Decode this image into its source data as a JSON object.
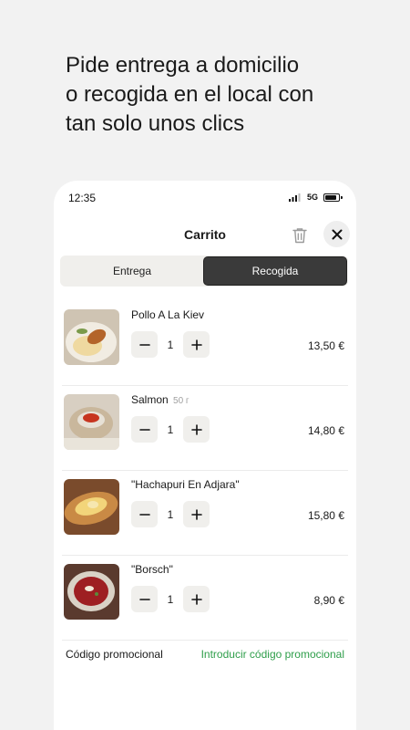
{
  "headline": {
    "line1": "Pide entrega a domicilio",
    "line2": "o recogida en el local con",
    "line3": "tan solo unos clics"
  },
  "status_bar": {
    "time": "12:35",
    "network": "5G"
  },
  "cart": {
    "title": "Carrito",
    "tabs": [
      {
        "label": "Entrega",
        "active": false
      },
      {
        "label": "Recogida",
        "active": true
      }
    ],
    "items": [
      {
        "name": "Pollo A La Kiev",
        "weight": "",
        "quantity": "1",
        "price": "13,50 €"
      },
      {
        "name": "Salmon",
        "weight": "50 г",
        "quantity": "1",
        "price": "14,80 €"
      },
      {
        "name": "\"Hachapuri En Adjara\"",
        "weight": "",
        "quantity": "1",
        "price": "15,80 €"
      },
      {
        "name": "\"Borsch\"",
        "weight": "",
        "quantity": "1",
        "price": "8,90 €"
      }
    ],
    "promo": {
      "label": "Código promocional",
      "link": "Introducir código promocional"
    }
  },
  "colors": {
    "accent_green": "#2e9e4a",
    "active_tab": "#3a3a3a",
    "background": "#f2f2f2"
  },
  "icons": [
    "signal-icon",
    "battery-icon",
    "trash-icon",
    "close-icon",
    "minus-icon",
    "plus-icon"
  ]
}
